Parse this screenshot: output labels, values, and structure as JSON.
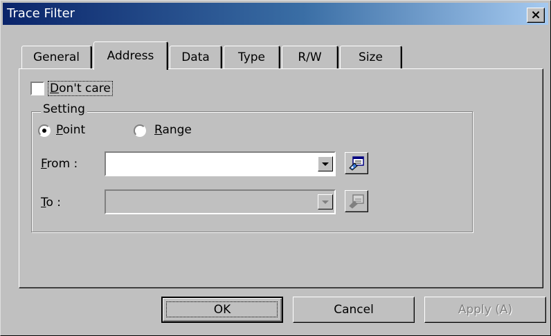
{
  "window": {
    "title": "Trace Filter",
    "close_glyph": "×"
  },
  "tabs": [
    {
      "label": "General",
      "active": false
    },
    {
      "label": "Address",
      "active": true
    },
    {
      "label": "Data",
      "active": false
    },
    {
      "label": "Type",
      "active": false
    },
    {
      "label": "R/W",
      "active": false
    },
    {
      "label": "Size",
      "active": false
    }
  ],
  "dont_care": {
    "label_mnemonic": "D",
    "label_rest": "on't care",
    "checked": false
  },
  "setting": {
    "legend": "Setting",
    "point": {
      "mnemonic": "P",
      "rest": "oint",
      "selected": true
    },
    "range": {
      "mnemonic": "R",
      "rest": "ange",
      "selected": false
    },
    "from": {
      "mnemonic": "F",
      "rest": "rom :",
      "value": "",
      "icon": "address-picker-icon"
    },
    "to": {
      "mnemonic": "T",
      "rest": "o :",
      "value": "",
      "disabled": true,
      "icon": "address-picker-icon"
    }
  },
  "buttons": {
    "ok": "OK",
    "cancel": "Cancel",
    "apply": "Apply (A)"
  },
  "colors": {
    "title_start": "#0a246a",
    "title_end": "#a6caf0",
    "face": "#c0c0c0"
  }
}
